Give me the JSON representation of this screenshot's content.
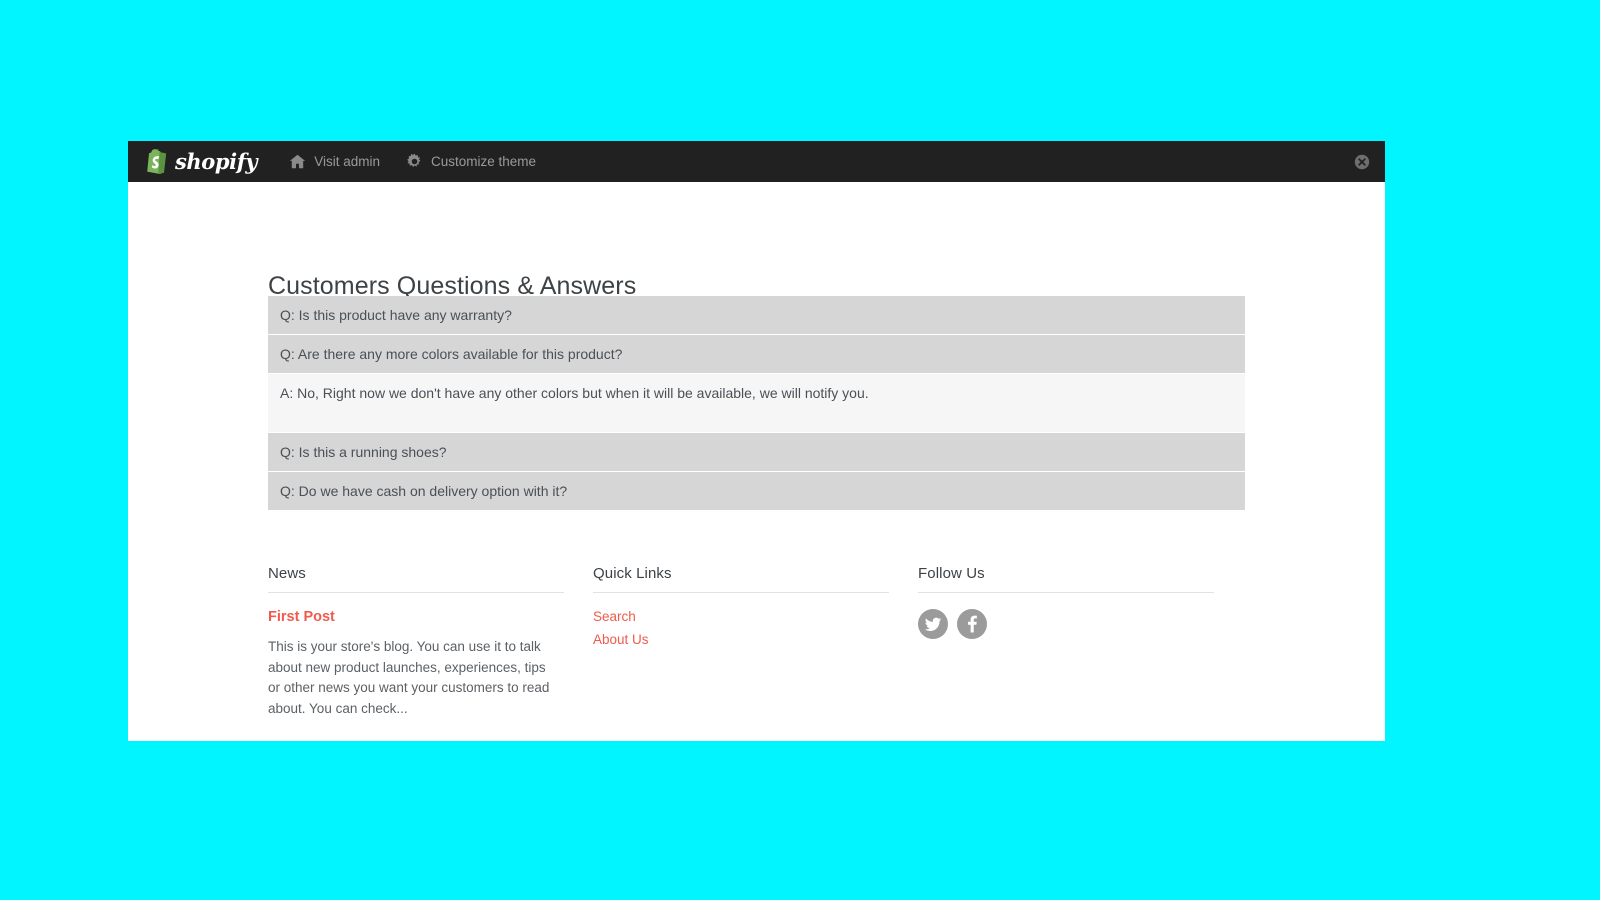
{
  "admin_bar": {
    "brand": "shopify",
    "brand_icon": "shopify-bag-icon",
    "nav": [
      {
        "label": "Visit admin",
        "icon": "home-icon"
      },
      {
        "label": "Customize theme",
        "icon": "gear-icon"
      }
    ],
    "close_icon": "close-circle-icon",
    "background_color": "#212121",
    "label_color": "#9a9a9a"
  },
  "page": {
    "title": "Customers Questions & Answers",
    "background_color": "#ffffff"
  },
  "faq": {
    "rows": [
      {
        "type": "question",
        "text": "Q: Is this product have any warranty?"
      },
      {
        "type": "question",
        "text": "Q: Are there any more colors available for this product?"
      },
      {
        "type": "answer",
        "text": "A: No, Right now we don't have any other colors but when it will be available, we will notify you."
      },
      {
        "type": "question",
        "text": "Q: Is this a running shoes?"
      },
      {
        "type": "question",
        "text": "Q: Do we have cash on delivery option with it?"
      }
    ],
    "question_background": "#d6d6d6",
    "answer_background": "#f6f6f6"
  },
  "footer": {
    "news": {
      "heading": "News",
      "post_title": "First Post",
      "post_excerpt": "This is your store's blog. You can use it to talk about new product launches, experiences, tips or other news you want your customers to read about. You can check..."
    },
    "quick_links": {
      "heading": "Quick Links",
      "links": [
        {
          "label": "Search"
        },
        {
          "label": "About Us"
        }
      ]
    },
    "follow_us": {
      "heading": "Follow Us",
      "social": [
        {
          "name": "twitter-icon"
        },
        {
          "name": "facebook-icon"
        }
      ]
    },
    "link_color": "#ef5b4c",
    "social_icon_color": "#9b9b9b"
  },
  "canvas": {
    "background_color": "#00f5ff"
  }
}
